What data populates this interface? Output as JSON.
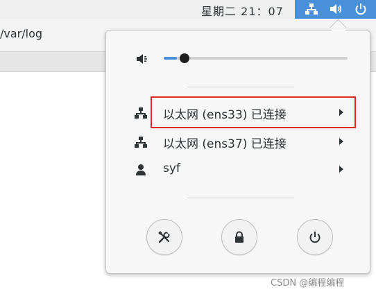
{
  "topbar": {
    "clock": "星期二 21：07",
    "tray_icons": [
      "network-wired-icon",
      "volume-icon",
      "power-icon"
    ],
    "tray_color": "#4a90d9"
  },
  "window": {
    "path": "/var/log"
  },
  "menu": {
    "volume": {
      "icon": "speaker-icon",
      "level": 0.07
    },
    "items": [
      {
        "icon": "network-wired-icon",
        "label": "以太网 (ens33) 已连接"
      },
      {
        "icon": "network-wired-icon",
        "label": "以太网 (ens37) 已连接"
      },
      {
        "icon": "user-icon",
        "label": "syf"
      }
    ],
    "buttons": [
      {
        "icon": "settings-tools-icon"
      },
      {
        "icon": "lock-icon"
      },
      {
        "icon": "power-icon"
      }
    ],
    "highlight_color": "#e0282a"
  },
  "watermark": "CSDN @编程编程"
}
